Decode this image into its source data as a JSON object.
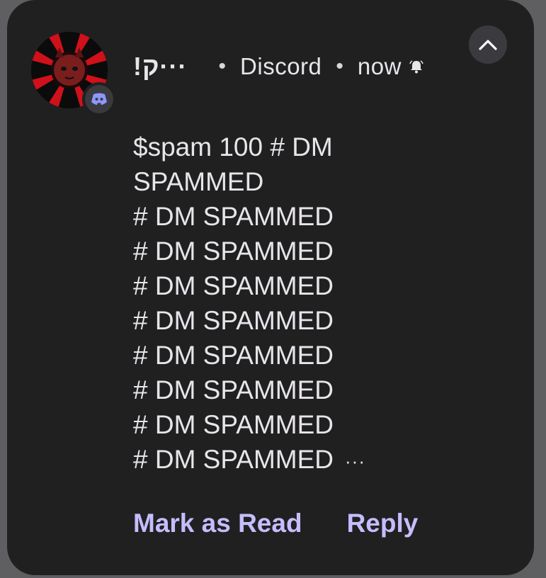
{
  "notification": {
    "sender": "!ק···",
    "app_name": "Discord",
    "separator": "•",
    "time": "now",
    "message_lines": [
      "$spam 100 # DM",
      "SPAMMED",
      "# DM SPAMMED",
      "# DM SPAMMED",
      "# DM SPAMMED",
      "# DM SPAMMED",
      "# DM SPAMMED",
      "# DM SPAMMED",
      "# DM SPAMMED",
      "# DM SPAMMED"
    ],
    "truncation": "···",
    "actions": {
      "mark_read": "Mark as Read",
      "reply": "Reply"
    }
  },
  "icons": {
    "avatar": "avatar-image",
    "app_badge": "discord-icon",
    "alert": "bell-icon",
    "collapse": "chevron-up-icon"
  },
  "colors": {
    "background": "#5f5f62",
    "card": "#202021",
    "text": "#e7e5ea",
    "accent": "#c5bdff",
    "avatar_red": "#d0101a"
  }
}
